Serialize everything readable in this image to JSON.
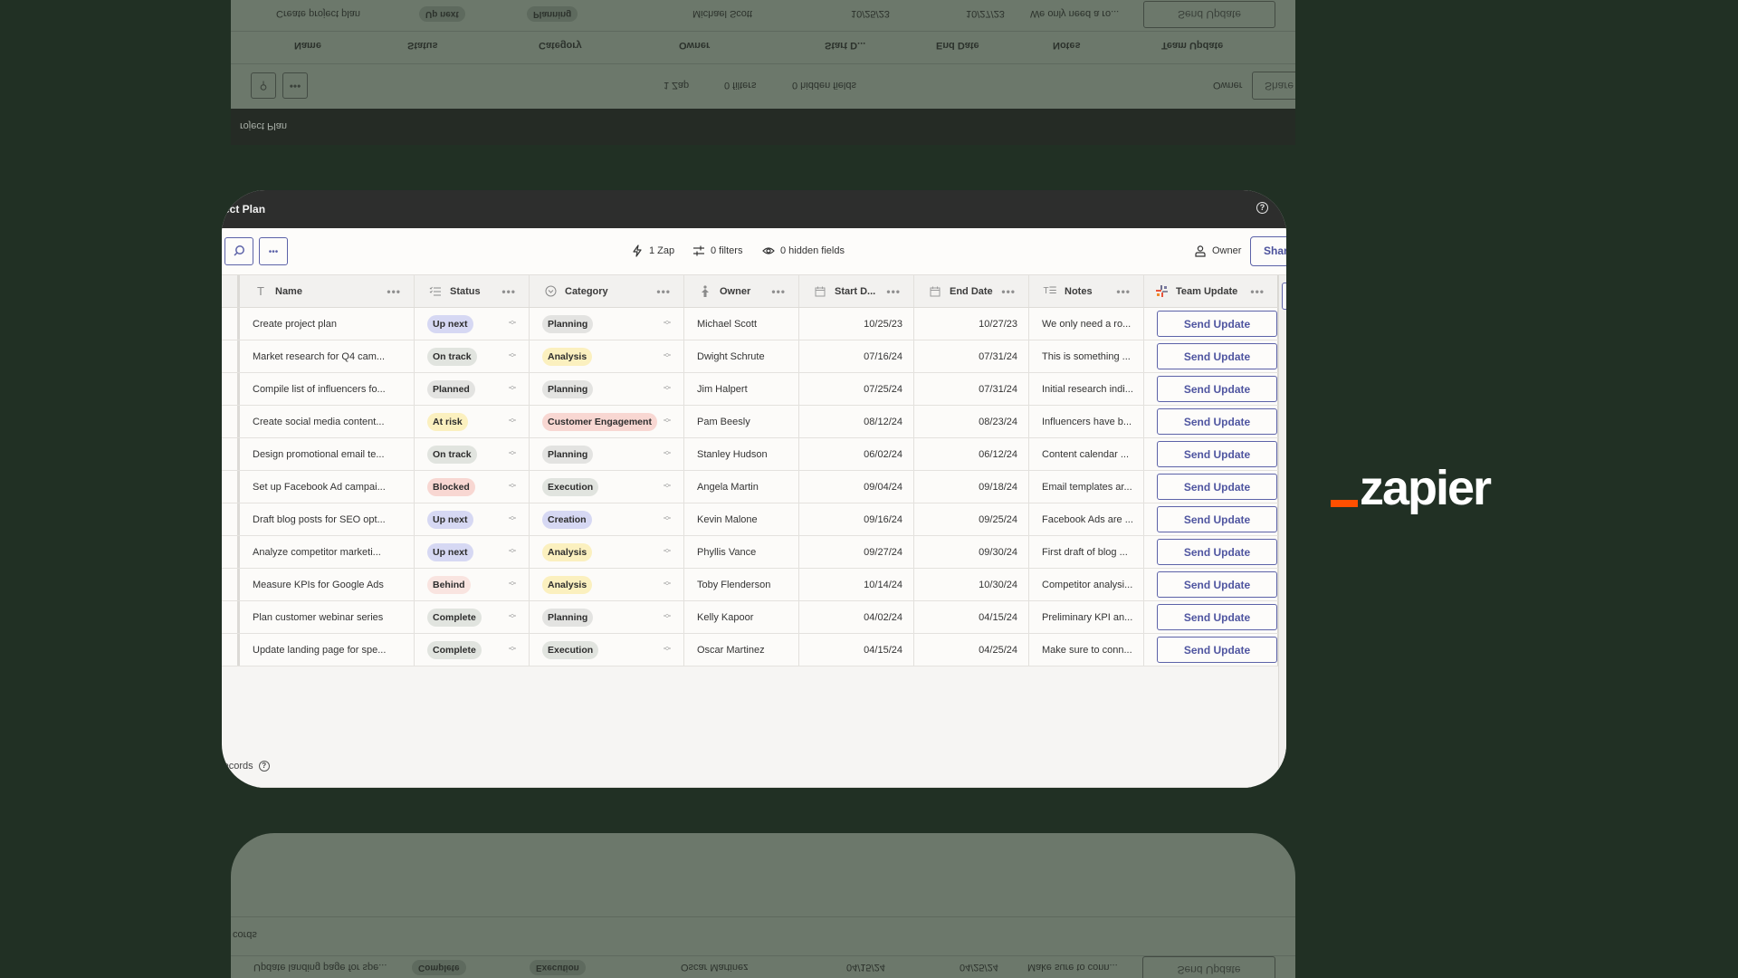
{
  "app": {
    "title": "ect Plan",
    "help_icon": "?",
    "brand": {
      "name": "zapier",
      "accent": "#ff4f00",
      "background": "#213024"
    }
  },
  "toolbar": {
    "search_icon": "search-icon",
    "more_icon": "•••",
    "zap_label": "1 Zap",
    "filters_label": "0 filters",
    "hidden_fields_label": "0 hidden fields",
    "owner_label": "Owner",
    "share_label": "Share"
  },
  "table": {
    "columns": [
      {
        "key": "name",
        "label": "Name",
        "icon": "T"
      },
      {
        "key": "status",
        "label": "Status",
        "icon": "checklist-icon"
      },
      {
        "key": "category",
        "label": "Category",
        "icon": "dropdown-circle-icon"
      },
      {
        "key": "owner",
        "label": "Owner",
        "icon": "person-icon"
      },
      {
        "key": "start",
        "label": "Start D...",
        "icon": "calendar-icon"
      },
      {
        "key": "end",
        "label": "End Date",
        "icon": "calendar-icon"
      },
      {
        "key": "notes",
        "label": "Notes",
        "icon": "long-text-icon"
      },
      {
        "key": "team",
        "label": "Team Update",
        "icon": "slack-icon"
      }
    ],
    "more_glyph": "•••",
    "button_label": "Send Update",
    "rows": [
      {
        "name": "Create project plan",
        "status": "Up next",
        "category": "Planning",
        "owner": "Michael Scott",
        "start": "10/25/23",
        "end": "10/27/23",
        "notes": "We only need a ro..."
      },
      {
        "name": "Market research for Q4 cam...",
        "status": "On track",
        "category": "Analysis",
        "owner": "Dwight Schrute",
        "start": "07/16/24",
        "end": "07/31/24",
        "notes": "This is something ..."
      },
      {
        "name": "Compile list of influencers fo...",
        "status": "Planned",
        "category": "Planning",
        "owner": "Jim Halpert",
        "start": "07/25/24",
        "end": "07/31/24",
        "notes": "Initial research indi..."
      },
      {
        "name": "Create social media content...",
        "status": "At risk",
        "category": "Customer Engagement",
        "owner": "Pam Beesly",
        "start": "08/12/24",
        "end": "08/23/24",
        "notes": "Influencers have b..."
      },
      {
        "name": "Design promotional email te...",
        "status": "On track",
        "category": "Planning",
        "owner": "Stanley Hudson",
        "start": "06/02/24",
        "end": "06/12/24",
        "notes": "Content calendar ..."
      },
      {
        "name": "Set up Facebook Ad campai...",
        "status": "Blocked",
        "category": "Execution",
        "owner": "Angela Martin",
        "start": "09/04/24",
        "end": "09/18/24",
        "notes": "Email templates ar..."
      },
      {
        "name": "Draft blog posts for SEO opt...",
        "status": "Up next",
        "category": "Creation",
        "owner": "Kevin Malone",
        "start": "09/16/24",
        "end": "09/25/24",
        "notes": "Facebook Ads are ..."
      },
      {
        "name": "Analyze competitor marketi...",
        "status": "Up next",
        "category": "Analysis",
        "owner": "Phyllis Vance",
        "start": "09/27/24",
        "end": "09/30/24",
        "notes": "First draft of blog ..."
      },
      {
        "name": "Measure KPIs for Google Ads",
        "status": "Behind",
        "category": "Analysis",
        "owner": "Toby Flenderson",
        "start": "10/14/24",
        "end": "10/30/24",
        "notes": "Competitor analysi..."
      },
      {
        "name": "Plan customer webinar series",
        "status": "Complete",
        "category": "Planning",
        "owner": "Kelly Kapoor",
        "start": "04/02/24",
        "end": "04/15/24",
        "notes": "Preliminary KPI an..."
      },
      {
        "name": "Update landing page for spe...",
        "status": "Complete",
        "category": "Execution",
        "owner": "Oscar Martinez",
        "start": "04/15/24",
        "end": "04/25/24",
        "notes": "Make sure to conn..."
      }
    ],
    "pill_colors": {
      "Up next": "#d6d8f3",
      "On track": "#e1e4df",
      "Planned": "#e3e3e1",
      "At risk": "#fbf0bf",
      "Blocked": "#f8d7d2",
      "Behind": "#f9e4e0",
      "Complete": "#e1e4df",
      "Planning": "#e3e3e1",
      "Analysis": "#fbf0bf",
      "Customer Engagement": "#f8d7d2",
      "Execution": "#e1e4df",
      "Creation": "#d6d8f3"
    }
  },
  "footer": {
    "records_label": "records",
    "help_icon": "?"
  },
  "reflection_top": {
    "title": "roject Plan",
    "row": {
      "name": "Create project plan",
      "status": "Up next",
      "category": "Planning",
      "owner": "Michael Scott",
      "start": "10/25/23",
      "end": "10/27/23",
      "notes": "We only need a ro...",
      "button": "Send Update"
    },
    "headers": [
      "Name",
      "Status",
      "Category",
      "Owner",
      "Start D...",
      "End Date",
      "Notes",
      "Team Update"
    ],
    "toolbar": {
      "zap": "1 Zap",
      "filters": "0 filters",
      "hidden": "0 hidden fields",
      "owner": "Owner",
      "share": "Share"
    }
  },
  "reflection_bottom": {
    "records": "cords",
    "row": {
      "name": "Update landing page for spe...",
      "status": "Complete",
      "category": "Execution",
      "owner": "Oscar Martinez",
      "start": "04/15/24",
      "end": "04/25/24",
      "notes": "Make sure to conn...",
      "button": "Send Update"
    }
  }
}
